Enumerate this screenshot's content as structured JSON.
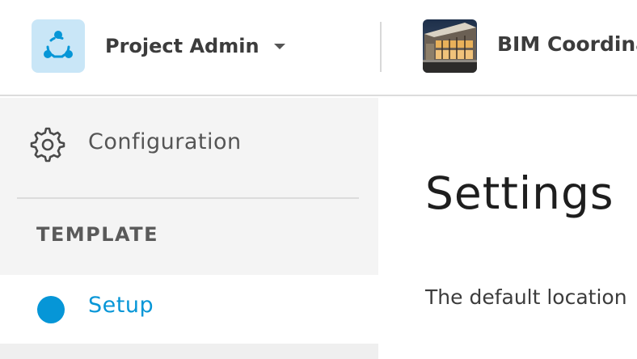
{
  "header": {
    "app_name": "Project Admin",
    "project_name": "BIM Coordination"
  },
  "sidebar": {
    "items": [
      {
        "label": "Configuration",
        "icon": "gear-icon"
      }
    ],
    "section_heading": "TEMPLATE",
    "active_item": {
      "label": "Setup",
      "icon": "status-dot-icon"
    }
  },
  "main": {
    "title": "Settings",
    "description": "The default location"
  },
  "colors": {
    "accent": "#0696d7",
    "app_icon_bg": "#c9e6f7",
    "sidebar_bg": "#f4f4f4"
  }
}
